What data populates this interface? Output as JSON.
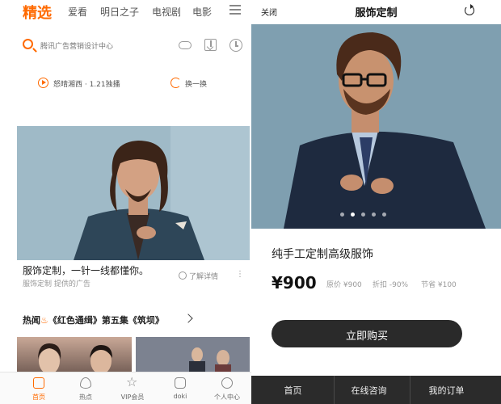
{
  "left": {
    "top_nav": {
      "tabs": [
        "精选",
        "爱看",
        "明日之子",
        "电视剧",
        "电影"
      ]
    },
    "search": {
      "placeholder": "腾讯广告营销设计中心"
    },
    "promo": {
      "text": "怒晴湘西 · 1.21独播",
      "refresh_label": "换一换"
    },
    "ad": {
      "title": "服饰定制，一针一线都懂你。",
      "source": "服饰定制 提供的广告",
      "learn_more": "了解详情",
      "more": "⋮"
    },
    "hot_news": {
      "label": "热闻",
      "flame": "♨",
      "headline": "《红色通缉》第五集《筑坝》"
    },
    "bottom_tabs": [
      "首页",
      "热点",
      "VIP会员",
      "doki",
      "个人中心"
    ]
  },
  "right": {
    "header": {
      "close": "关闭",
      "title": "服饰定制"
    },
    "carousel": {
      "count": 5,
      "active_index": 1
    },
    "product": {
      "title": "纯手工定制高级服饰",
      "price": "¥900",
      "original_price": "原价 ¥900",
      "discount": "折扣 -90%",
      "savings": "节省 ¥100"
    },
    "buy_button": "立即购买",
    "footer_tabs": [
      "首页",
      "在线咨询",
      "我的订单"
    ]
  },
  "colors": {
    "accent": "#ff6a00",
    "dark": "#2a2a2a"
  }
}
